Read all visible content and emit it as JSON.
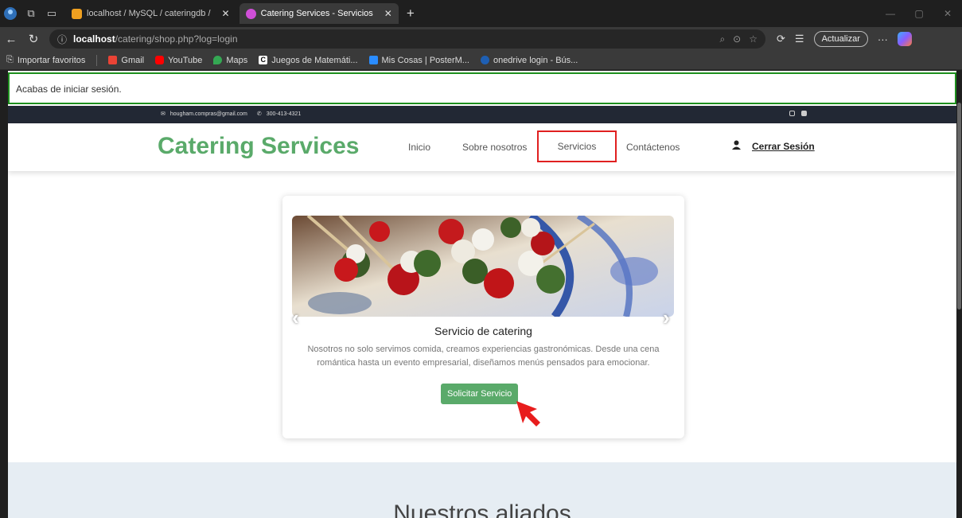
{
  "browser": {
    "tabs": [
      {
        "label": "localhost / MySQL / cateringdb /",
        "active": false
      },
      {
        "label": "Catering Services - Servicios",
        "active": true
      }
    ],
    "url_host": "localhost",
    "url_path": "/catering/shop.php?log=login",
    "update_label": "Actualizar",
    "bookmarks": [
      {
        "label": "Importar favoritos",
        "icon": "import-icon"
      },
      {
        "label": "Gmail",
        "icon": "gmail-icon"
      },
      {
        "label": "YouTube",
        "icon": "youtube-icon"
      },
      {
        "label": "Maps",
        "icon": "maps-icon"
      },
      {
        "label": "Juegos de Matemáti...",
        "icon": "c-icon"
      },
      {
        "label": "Mis Cosas | PosterM...",
        "icon": "poster-icon"
      },
      {
        "label": "onedrive login - Bús...",
        "icon": "search-icon"
      }
    ]
  },
  "alert": {
    "text": "Acabas de iniciar sesión."
  },
  "topbar": {
    "email": "hougham.compras@gmail.com",
    "phone": "300-413-4321"
  },
  "header": {
    "brand": "Catering Services",
    "nav": [
      "Inicio",
      "Sobre nosotros",
      "Servicios",
      "Contáctenos"
    ],
    "logout": "Cerrar Sesión"
  },
  "card": {
    "title": "Servicio de catering",
    "description": "Nosotros no solo servimos comida, creamos experiencias gastronómicas. Desde una cena romántica hasta un evento empresarial, diseñamos menús pensados para emocionar.",
    "button": "Solicitar Servicio"
  },
  "partners": {
    "title": "Nuestros aliados"
  },
  "colors": {
    "brand_green": "#5aaa6a",
    "highlight_red": "#e02020",
    "alert_green": "#1e8f1e",
    "topbar_dark": "#222834"
  }
}
